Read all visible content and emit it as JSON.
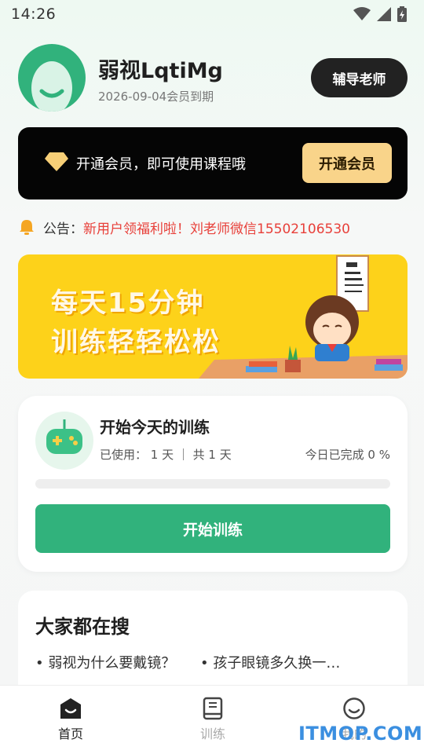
{
  "status_bar": {
    "time": "14:26",
    "icons": [
      "wifi-icon",
      "signal-icon",
      "battery-icon"
    ]
  },
  "profile": {
    "name": "弱视LqtiMg",
    "member_expiry": "2026-09-04会员到期",
    "tutor_button": "辅导老师"
  },
  "vip": {
    "text": "开通会员，即可使用课程哦",
    "button": "开通会员"
  },
  "notice": {
    "label": "公告：",
    "text": "新用户领福利啦！刘老师微信15502106530"
  },
  "banner": {
    "line1": "每天15分钟",
    "line2": "训练轻轻松松"
  },
  "training": {
    "title": "开始今天的训练",
    "used": "已使用： 1 天 ｜ 共 1 天",
    "today": "今日已完成 0 %",
    "progress": 0,
    "button": "开始训练"
  },
  "search": {
    "title": "大家都在搜",
    "items": [
      "•  弱视为什么要戴镜？",
      "•  孩子眼镜多久换一…"
    ]
  },
  "tabbar": {
    "items": [
      {
        "label": "首页",
        "icon": "home-icon",
        "active": true
      },
      {
        "label": "训练",
        "icon": "book-icon",
        "active": false
      },
      {
        "label": "我的",
        "icon": "profile-icon",
        "active": false
      }
    ]
  },
  "watermark": "ITMOP.COM",
  "colors": {
    "accent": "#31b27c",
    "notice": "#e8403a",
    "vip_button": "#f9d48a",
    "banner": "#fdd21a"
  }
}
